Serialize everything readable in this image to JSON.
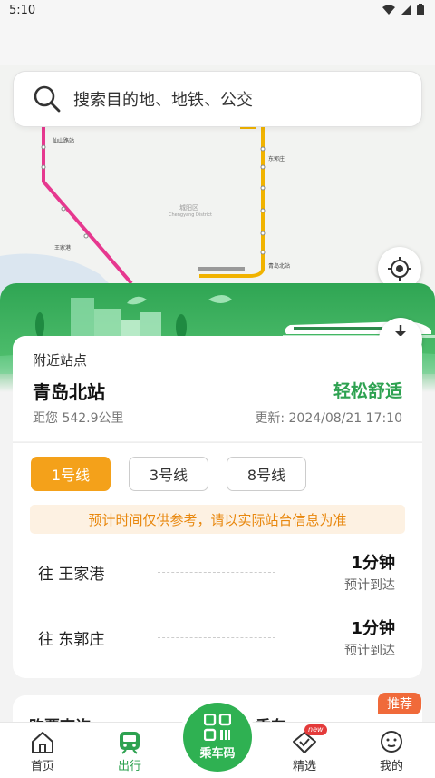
{
  "status_bar": {
    "time": "5:10"
  },
  "search": {
    "placeholder": "搜索目的地、地铁、公交"
  },
  "map": {
    "district": "城阳区",
    "district_en": "Chengyang District",
    "labels": [
      "仙山路站",
      "青岛北站",
      "东郭庄",
      "王家港"
    ]
  },
  "download": {
    "label": "下载"
  },
  "station": {
    "section_title": "附近站点",
    "name": "青岛北站",
    "comfort": "轻松舒适",
    "distance": "距您 542.9公里",
    "updated": "更新: 2024/08/21 17:10"
  },
  "line_tabs": [
    {
      "label": "1号线",
      "active": true
    },
    {
      "label": "3号线",
      "active": false
    },
    {
      "label": "8号线",
      "active": false
    }
  ],
  "notice": "预计时间仅供参考，请以实际站台信息为准",
  "arrivals": [
    {
      "direction": "往 王家港",
      "minutes": "1分钟",
      "status": "预计到达"
    },
    {
      "direction": "往 东郭庄",
      "minutes": "1分钟",
      "status": "预计到达"
    }
  ],
  "promo": {
    "left": "购票查询 ›",
    "right": "乘车 ›",
    "badge": "推荐"
  },
  "tabbar": {
    "home": "首页",
    "travel": "出行",
    "qr": "乘车码",
    "featured": "精选",
    "featured_badge": "new",
    "mine": "我的"
  },
  "colors": {
    "brand_green": "#2ea251",
    "accent_orange": "#f4a11a",
    "line1_red": "#e6388f",
    "line_yellow": "#f1b300"
  }
}
